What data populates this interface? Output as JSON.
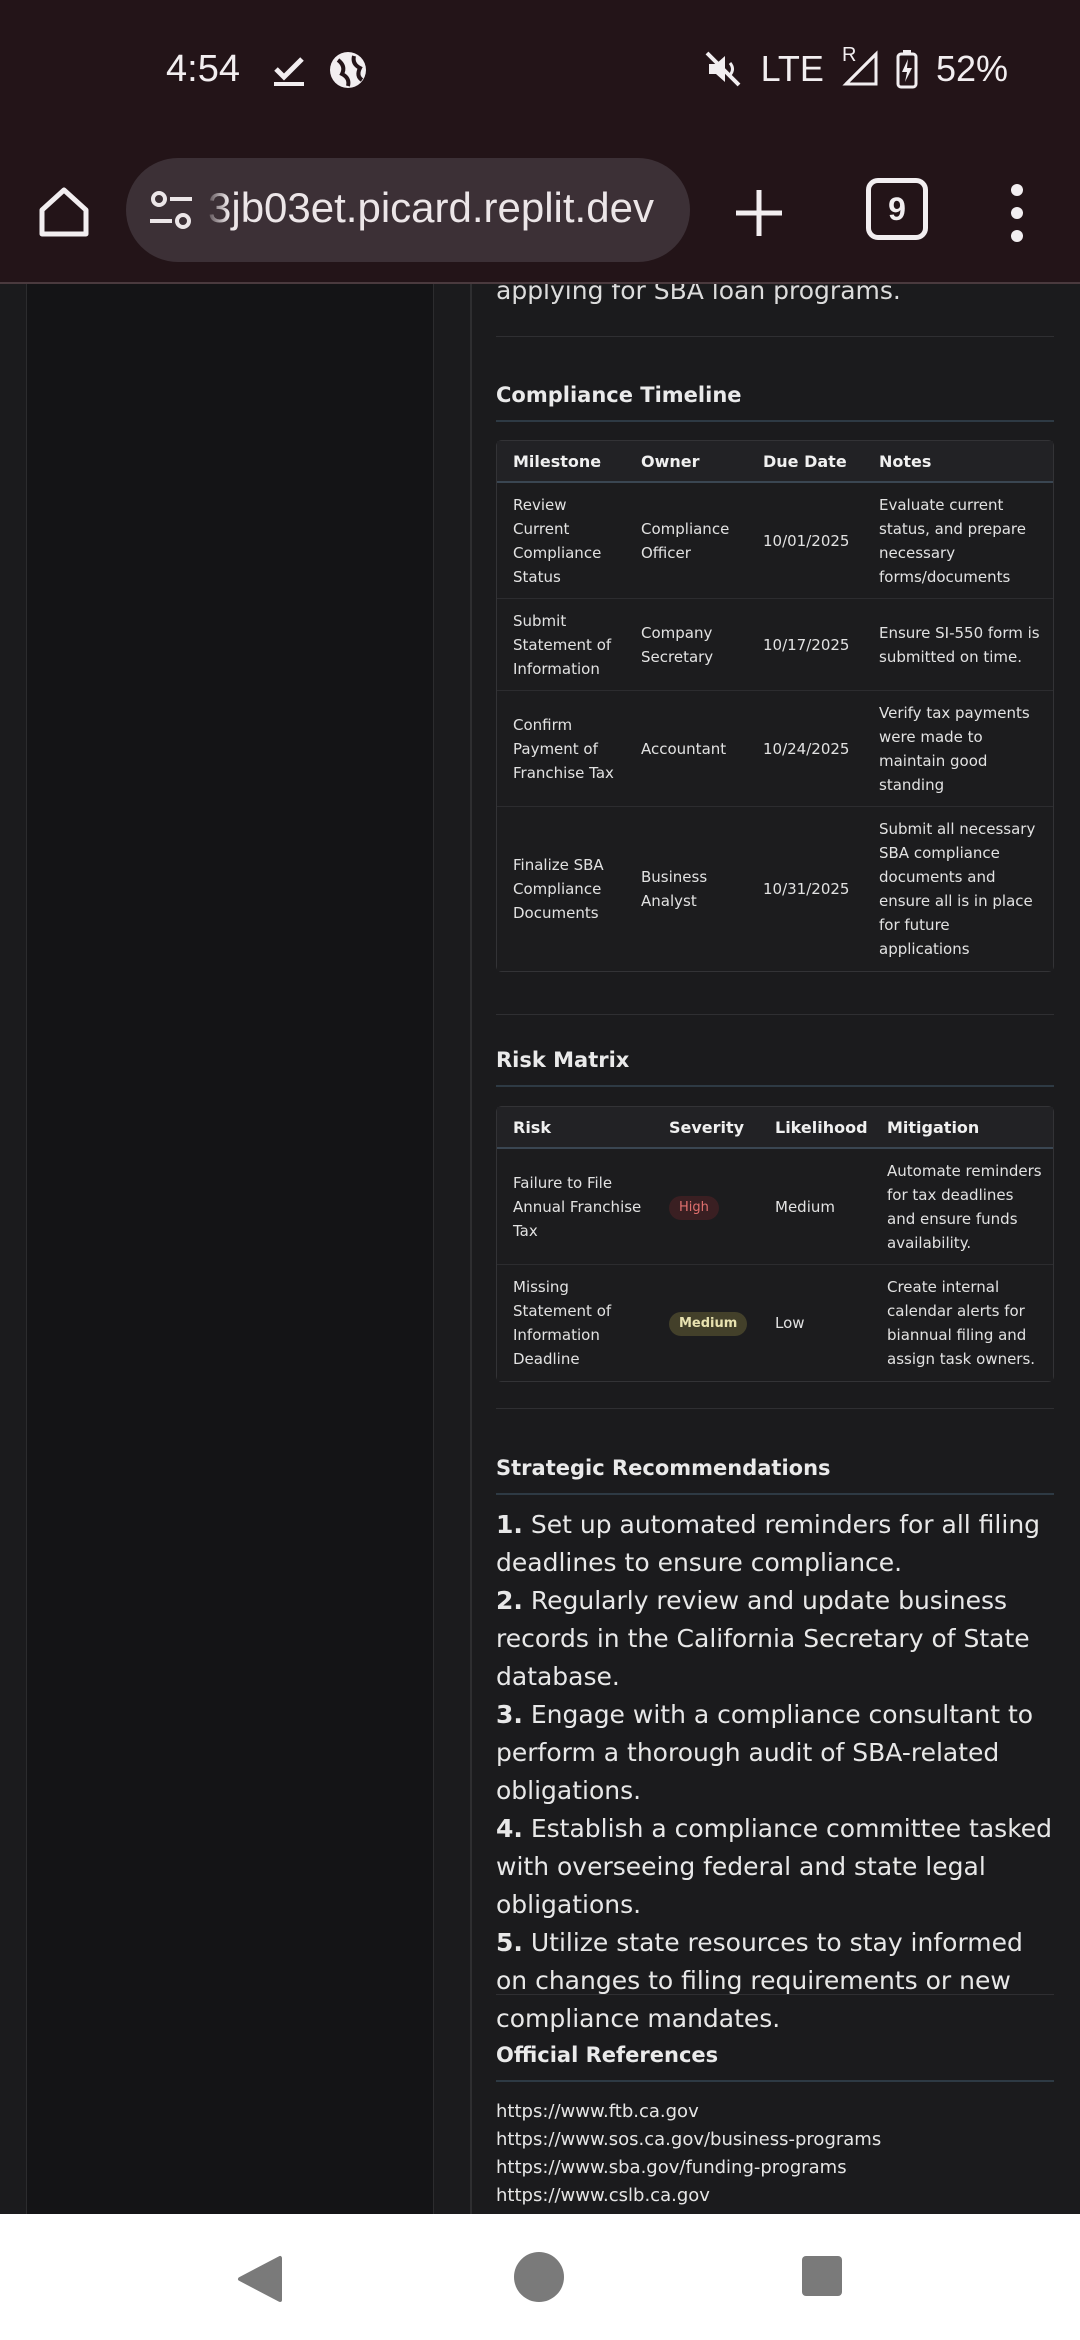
{
  "status_bar": {
    "time": "4:54",
    "network": "LTE",
    "roaming": "R",
    "battery": "52%",
    "icons": [
      "check-download-icon",
      "globe-icon",
      "mute-icon",
      "signal-icon",
      "battery-charging-icon"
    ]
  },
  "browser": {
    "url": "3jb03et.picard.replit.dev",
    "tab_count": "9"
  },
  "page": {
    "intro_tail": "applying for SBA loan programs.",
    "timeline": {
      "title": "Compliance Timeline",
      "headers": [
        "Milestone",
        "Owner",
        "Due Date",
        "Notes"
      ],
      "rows": [
        [
          "Review Current Compliance Status",
          "Compliance Officer",
          "10/01/2025",
          "Evaluate current status, and prepare necessary forms/documents"
        ],
        [
          "Submit Statement of Information",
          "Company Secretary",
          "10/17/2025",
          "Ensure SI-550 form is submitted on time."
        ],
        [
          "Confirm Payment of Franchise Tax",
          "Accountant",
          "10/24/2025",
          "Verify tax payments were made to maintain good standing"
        ],
        [
          "Finalize SBA Compliance Documents",
          "Business Analyst",
          "10/31/2025",
          "Submit all necessary SBA compliance documents and ensure all is in place for future applications"
        ]
      ]
    },
    "risk": {
      "title": "Risk Matrix",
      "headers": [
        "Risk",
        "Severity",
        "Likelihood",
        "Mitigation"
      ],
      "rows": [
        [
          "Failure to File Annual Franchise Tax",
          "High",
          "Medium",
          "Automate reminders for tax deadlines and ensure funds availability."
        ],
        [
          "Missing Statement of Information Deadline",
          "Medium",
          "Low",
          "Create internal calendar alerts for biannual filing and assign task owners."
        ]
      ],
      "colors": {
        "high_badge": "#3a1f22",
        "medium_badge": "#43402a"
      }
    },
    "recommendations": {
      "title": "Strategic Recommendations",
      "items": [
        {
          "num": "1.",
          "text": "Set up automated reminders for all filing deadlines to ensure compliance."
        },
        {
          "num": "2.",
          "text": "Regularly review and update business records in the California Secretary of State database."
        },
        {
          "num": "3.",
          "text": "Engage with a compliance consultant to perform a thorough audit of SBA-related obligations."
        },
        {
          "num": "4.",
          "text": "Establish a compliance committee tasked with overseeing federal and state legal obligations."
        },
        {
          "num": "5.",
          "text": "Utilize state resources to stay informed on changes to filing requirements or new compliance mandates."
        }
      ]
    },
    "references": {
      "title": "Official References",
      "links": [
        "https://www.ftb.ca.gov",
        "https://www.sos.ca.gov/business-programs",
        "https://www.sba.gov/funding-programs",
        "https://www.cslb.ca.gov"
      ]
    }
  }
}
